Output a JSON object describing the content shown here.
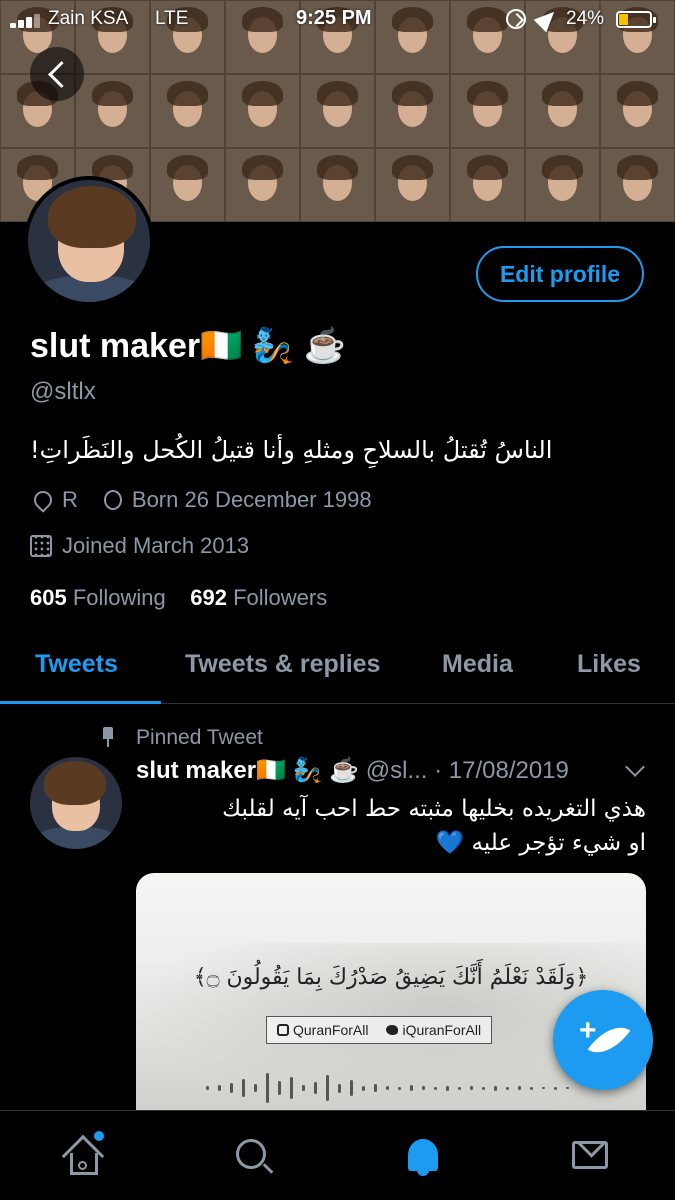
{
  "status_bar": {
    "carrier": "Zain KSA",
    "network": "LTE",
    "time": "9:25 PM",
    "battery": "24%"
  },
  "profile": {
    "edit_label": "Edit profile",
    "display_name": "slut maker🇨🇮 🧞 ☕",
    "handle": "@sltlx",
    "bio": "الناسُ تُقتلُ بالسلاحِ ومثلهِ وأنا قتيلُ الكُحل والنَظَراتِ!",
    "location": "R",
    "birthday": "Born 26 December 1998",
    "joined": "Joined March 2013",
    "following_count": "605",
    "following_label": "Following",
    "followers_count": "692",
    "followers_label": "Followers"
  },
  "tabs": [
    {
      "label": "Tweets"
    },
    {
      "label": "Tweets & replies"
    },
    {
      "label": "Media"
    },
    {
      "label": "Likes"
    }
  ],
  "pinned_tweet": {
    "pinned_label": "Pinned Tweet",
    "name": "slut maker🇨🇮 🧞 ☕",
    "handle": "@sl...",
    "date": "· 17/08/2019",
    "text_line1": "هذي التغريده بخليها مثبته حط احب آيه لقلبك",
    "text_line2": "او شيء تؤجر عليه 💙",
    "media": {
      "verse": "﴿وَلَقَدْ نَعْلَمُ أَنَّكَ يَضِيقُ صَدْرُكَ بِمَا يَقُولُونَ ۝﴾",
      "instagram": "QuranForAll",
      "twitter": "iQuranForAll"
    }
  },
  "icons": {
    "back": "back-arrow-icon",
    "compose": "compose-tweet-icon",
    "nav": [
      "home-icon",
      "search-icon",
      "notifications-bell-icon",
      "messages-mail-icon"
    ]
  },
  "colors": {
    "accent": "#1d9bf0",
    "secondary_text": "#8b98a5",
    "background": "#000000"
  }
}
